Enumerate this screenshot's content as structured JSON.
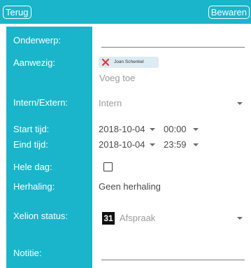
{
  "header": {
    "back_label": "Terug",
    "save_label": "Bewaren"
  },
  "labels": {
    "subject": "Onderwerp:",
    "attendees": "Aanwezig:",
    "intern_extern": "Intern/Extern:",
    "start_time": "Start tijd:",
    "end_time": "Eind tijd:",
    "all_day": "Hele dag:",
    "repeat": "Herhaling:",
    "xelion_status": "Xelion status:",
    "note": "Notitie:"
  },
  "fields": {
    "subject_value": "",
    "attendee_chip": "Joan Schenkel",
    "add_attendee_placeholder": "Voeg toe",
    "intern_extern_value": "Intern",
    "start_date": "2018-10-04",
    "start_time": "00:00",
    "end_date": "2018-10-04",
    "end_time": "23:59",
    "all_day_checked": false,
    "repeat_value": "Geen herhaling",
    "status_icon_number": "31",
    "status_value": "Afspraak",
    "note_value": ""
  },
  "icons": {
    "chip_remove": "close-icon",
    "dropdown": "chevron-down-icon",
    "status": "calendar-icon"
  },
  "colors": {
    "accent": "#1ab5cb",
    "chip_background": "#dcebf4",
    "chip_remove": "#e53935"
  }
}
